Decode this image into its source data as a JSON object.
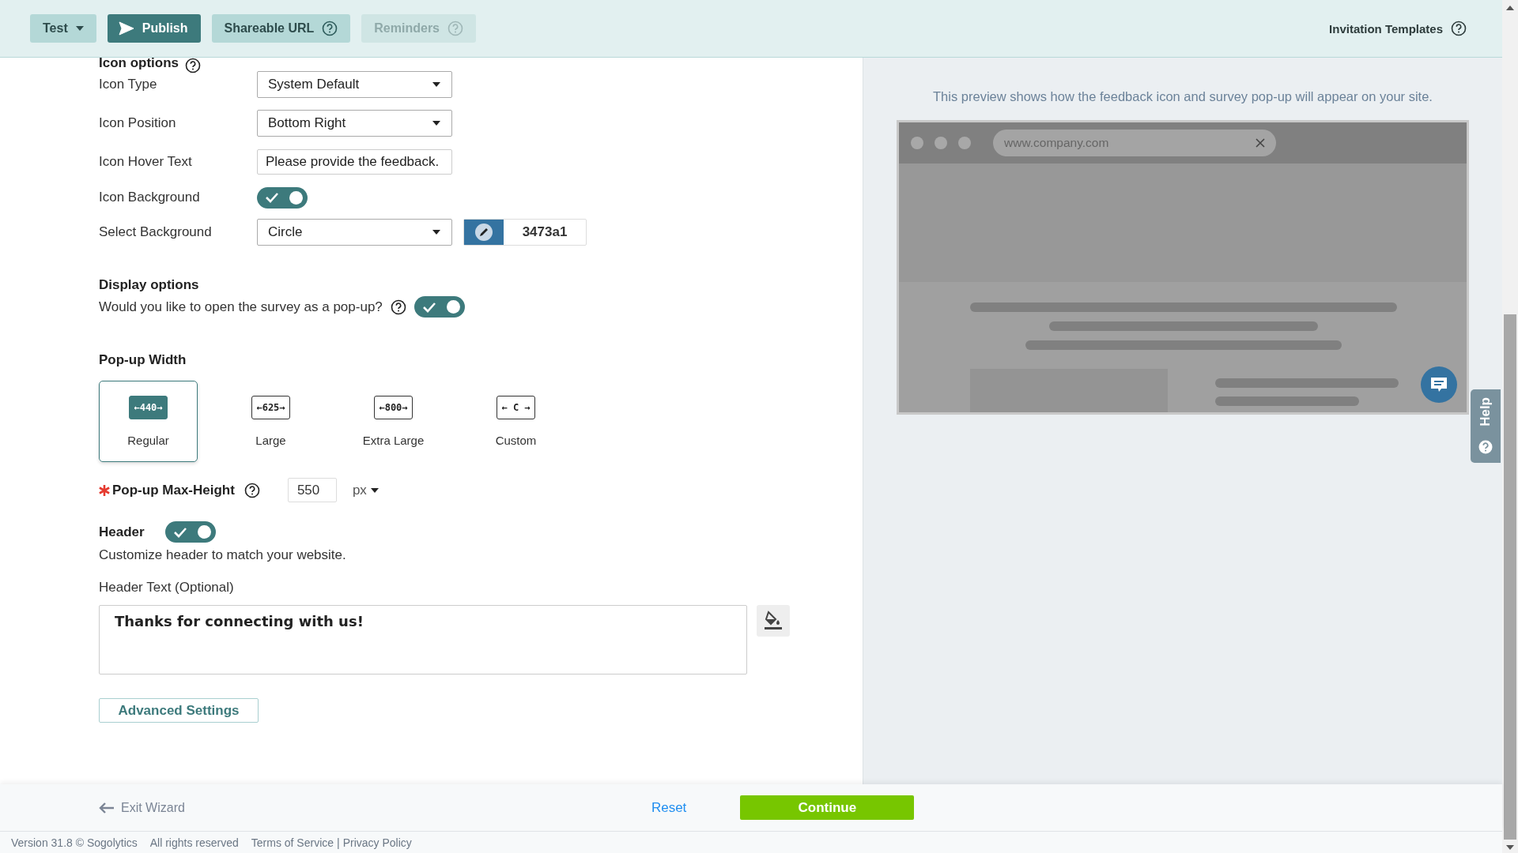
{
  "toolbar": {
    "buttons": [
      {
        "label": "Test",
        "kind": "dropdown",
        "disabled": false
      },
      {
        "label": "Publish",
        "kind": "primary",
        "disabled": false
      },
      {
        "label": "Shareable URL",
        "kind": "help",
        "disabled": false
      },
      {
        "label": "Reminders",
        "kind": "help",
        "disabled": true
      }
    ],
    "right_link": "Invitation Templates"
  },
  "icon_options": {
    "title": "Icon options",
    "fields": [
      {
        "label": "Icon Type",
        "kind": "select",
        "value": "System Default"
      },
      {
        "label": "Icon Position",
        "kind": "select",
        "value": "Bottom Right"
      },
      {
        "label": "Icon Hover Text",
        "kind": "text",
        "value": "Please provide the feedback."
      },
      {
        "label": "Icon Background",
        "kind": "toggle",
        "on": true
      },
      {
        "label": "Select Background",
        "kind": "select-color",
        "value": "Circle",
        "color_value": "3473a1"
      }
    ]
  },
  "display_options": {
    "title": "Display options",
    "question": "Would you like to open the survey as a pop-up?",
    "popup_on": true
  },
  "popup_width": {
    "title": "Pop-up Width",
    "options": [
      {
        "label": "Regular",
        "size": "←440→",
        "selected": true
      },
      {
        "label": "Large",
        "size": "←625→",
        "selected": false
      },
      {
        "label": "Extra Large",
        "size": "←800→",
        "selected": false
      },
      {
        "label": "Custom",
        "size": "← C →",
        "selected": false
      }
    ]
  },
  "max_height": {
    "label": "Pop-up Max-Height",
    "required": true,
    "value": "550",
    "unit": "px"
  },
  "header": {
    "label": "Header",
    "on": true,
    "hint": "Customize header to match your website.",
    "text_label": "Header Text (Optional)",
    "text": "Thanks for connecting with us!"
  },
  "advanced_button": "Advanced Settings",
  "preview": {
    "caption": "This preview shows how the feedback icon and survey pop-up will appear on your site.",
    "url_placeholder": "www.company.com"
  },
  "help_tab": "Help",
  "bottom_bar": {
    "exit": "Exit Wizard",
    "reset": "Reset",
    "continue": "Continue"
  },
  "footer": {
    "version": "Version 31.8 © Sogolytics",
    "rights": "All rights reserved",
    "terms": "Terms of Service",
    "separator": "|",
    "privacy": "Privacy Policy"
  }
}
